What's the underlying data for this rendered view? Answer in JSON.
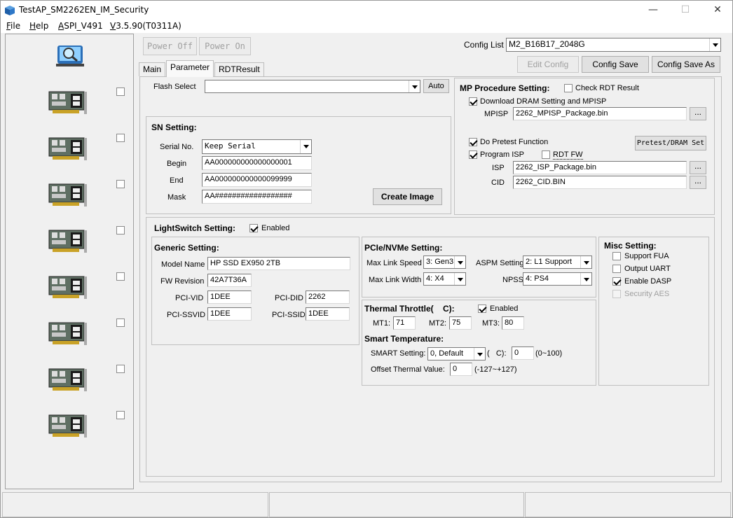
{
  "window": {
    "title": "TestAP_SM2262EN_IM_Security",
    "minimize": "—",
    "maximize": "☐",
    "close": "✕"
  },
  "menu": [
    "File",
    "Help",
    "ASPI_V491",
    "V3.5.90(T0311A)"
  ],
  "toolbar": {
    "power_off": "Power Off",
    "power_on": "Power On",
    "config_list_label": "Config List",
    "config_list_value": "M2_B16B17_2048G",
    "edit_config": "Edit Config",
    "config_save": "Config Save",
    "config_save_as": "Config Save As"
  },
  "tabs": [
    "Main",
    "Parameter",
    "RDTResult"
  ],
  "flash": {
    "label": "Flash Select",
    "value": "",
    "auto": "Auto"
  },
  "sn": {
    "title": "SN Setting:",
    "serial_label": "Serial No.",
    "serial_value": "Keep Serial",
    "begin_label": "Begin",
    "begin_value": "AA000000000000000001",
    "end_label": "End",
    "end_value": "AA000000000000099999",
    "mask_label": "Mask",
    "mask_value": "AA##################",
    "create_image": "Create Image"
  },
  "mp": {
    "title": "MP Procedure Setting:",
    "check_rdt": "Check RDT Result",
    "download_dram": "Download DRAM Setting and MPISP",
    "mpisp_label": "MPISP",
    "mpisp_value": "2262_MPISP_Package.bin",
    "browse": "...",
    "pretest": "Do Pretest Function",
    "pretest_btn": "Pretest/DRAM Set",
    "program_isp": "Program ISP",
    "rdt_fw": "RDT FW",
    "isp_label": "ISP",
    "isp_value": "2262_ISP_Package.bin",
    "cid_label": "CID",
    "cid_value": "2262_CID.BIN"
  },
  "lightswitch": {
    "title": "LightSwitch Setting:",
    "enabled": "Enabled"
  },
  "generic": {
    "title": "Generic Setting:",
    "model_label": "Model Name",
    "model_value": "HP SSD EX950 2TB",
    "fw_label": "FW Revision",
    "fw_value": "42A7T36A",
    "vid_label": "PCI-VID",
    "vid_value": "1DEE",
    "did_label": "PCI-DID",
    "did_value": "2262",
    "ssvid_label": "PCI-SSVID",
    "ssvid_value": "1DEE",
    "ssid_label": "PCI-SSID",
    "ssid_value": "1DEE"
  },
  "pcie": {
    "title": "PCIe/NVMe Setting:",
    "speed_label": "Max Link Speed",
    "speed_value": "3: Gen3",
    "aspm_label": "ASPM Setting",
    "aspm_value": "2: L1 Support",
    "width_label": "Max Link Width",
    "width_value": "4: X4",
    "npss_label": "NPSS",
    "npss_value": "4: PS4"
  },
  "thermal": {
    "title": "Thermal Throttle(    C):",
    "enabled": "Enabled",
    "mt1_label": "MT1:",
    "mt1_value": "71",
    "mt2_label": "MT2:",
    "mt2_value": "75",
    "mt3_label": "MT3:",
    "mt3_value": "80"
  },
  "smart": {
    "title": "Smart Temperature:",
    "setting_label": "SMART Setting:",
    "setting_value": "0, Default",
    "unit_label": "(   C):",
    "unit_value": "0",
    "range1": "(0~100)",
    "offset_label": "Offset Thermal Value:",
    "offset_value": "0",
    "range2": "(-127~+127)"
  },
  "misc": {
    "title": "Misc Setting:",
    "fua": "Support FUA",
    "uart": "Output UART",
    "dasp": "Enable DASP",
    "aes": "Security AES"
  }
}
